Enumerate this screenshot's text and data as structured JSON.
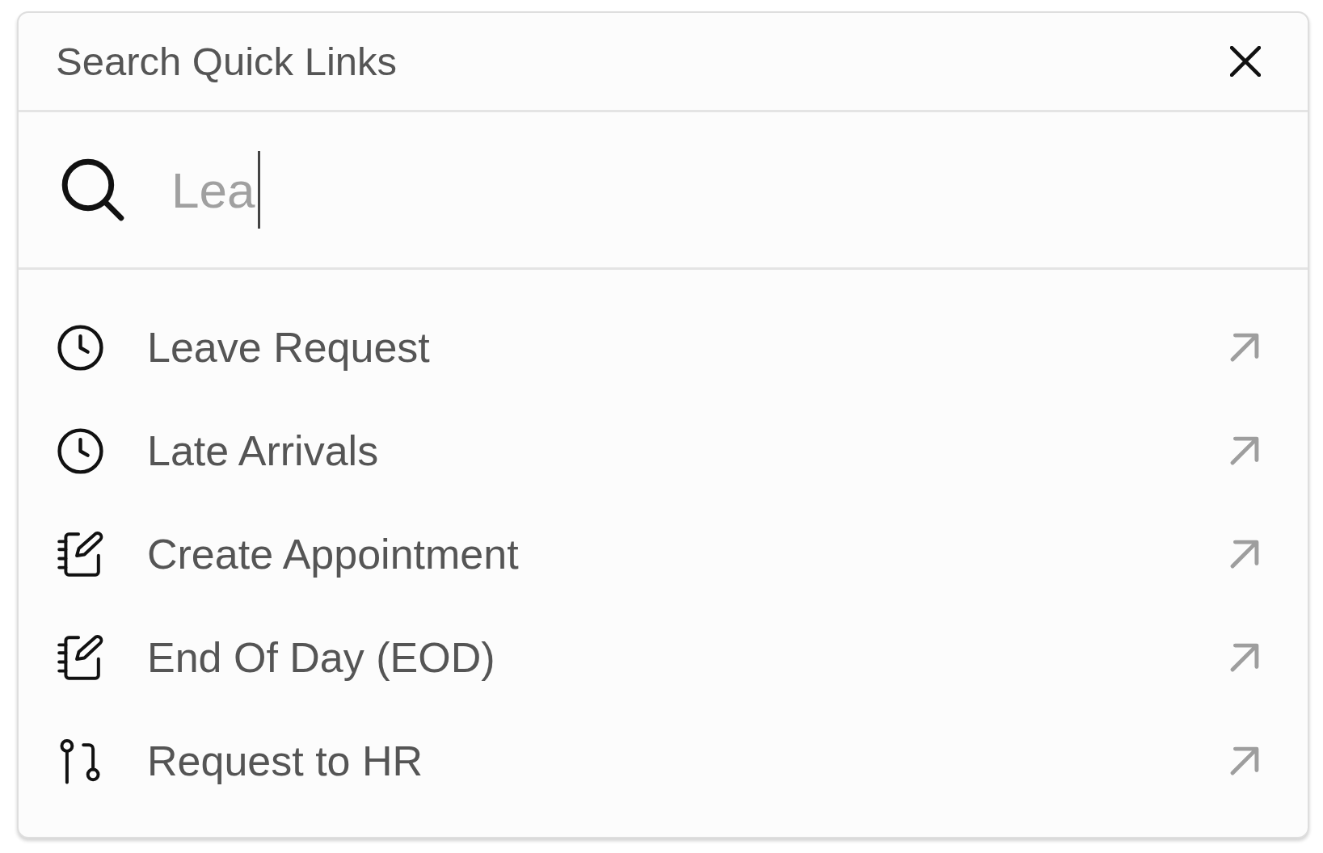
{
  "dialog": {
    "title": "Search Quick Links"
  },
  "search": {
    "value": "Lea",
    "focused": true
  },
  "links": [
    {
      "label": "Leave Request",
      "kind": "clock"
    },
    {
      "label": "Late Arrivals",
      "kind": "clock"
    },
    {
      "label": "Create Appointment",
      "kind": "notebook"
    },
    {
      "label": "End Of Day (EOD)",
      "kind": "notebook"
    },
    {
      "label": "Request to HR",
      "kind": "branch"
    }
  ]
}
